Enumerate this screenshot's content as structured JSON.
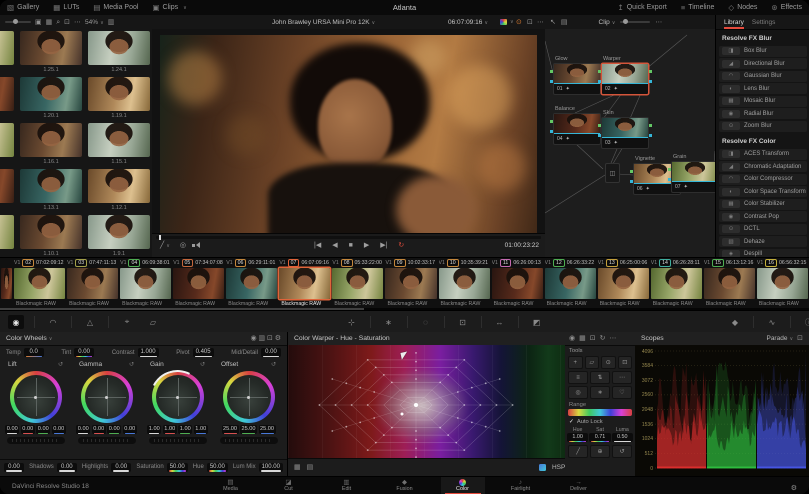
{
  "top_bar": {
    "gallery_label": "Gallery",
    "luts_label": "LUTs",
    "media_pool_label": "Media Pool",
    "clips_label": "Clips",
    "title": "Atlanta",
    "quick_export_label": "Quick Export",
    "timeline_label": "Timeline",
    "nodes_label": "Nodes",
    "effects_label": "Effects"
  },
  "gallery": {
    "zoom_level": "54%",
    "stills": [
      "1.25.1",
      "1.24.1",
      "1.20.1",
      "1.19.1",
      "1.16.1",
      "1.15.1",
      "1.13.1",
      "1.12.1",
      "1.10.1",
      "1.9.1"
    ]
  },
  "viewer": {
    "clip_name": "John Brawley URSA Mini Pro 12K",
    "timecode": "06:07:09:16",
    "duration": "01:00:23:22"
  },
  "node_graph": {
    "mode": "Clip",
    "nodes": [
      {
        "id": "01",
        "name": "Glow"
      },
      {
        "id": "02",
        "name": "Warper",
        "selected": true
      },
      {
        "id": "04",
        "name": "Balance"
      },
      {
        "id": "03",
        "name": "Skin"
      },
      {
        "id": "06",
        "name": "Vignette"
      },
      {
        "id": "07",
        "name": "Grain"
      }
    ]
  },
  "library": {
    "tabs": [
      "Library",
      "Settings"
    ],
    "active_tab": "Library",
    "sections": [
      {
        "title": "Resolve FX Blur",
        "items": [
          "Box Blur",
          "Directional Blur",
          "Gaussian Blur",
          "Lens Blur",
          "Mosaic Blur",
          "Radial Blur",
          "Zoom Blur"
        ]
      },
      {
        "title": "Resolve FX Color",
        "items": [
          "ACES Transform",
          "Chromatic Adaptation",
          "Color Compressor",
          "Color Space Transform",
          "Color Stabilizer",
          "Contrast Pop",
          "DCTL",
          "Dehaze",
          "Despill"
        ]
      }
    ]
  },
  "timeline": {
    "track": "V1",
    "format": "Blackmagic RAW",
    "clips": [
      {
        "num": "02",
        "tc": "07:02:09:12",
        "flag": "#c4873c"
      },
      {
        "num": "03",
        "tc": "07:47:11:13",
        "flag": "#a3a04a"
      },
      {
        "num": "04",
        "tc": "06:09:38:01",
        "flag": "#4fae52"
      },
      {
        "num": "05",
        "tc": "07:34:07:08",
        "flag": "#c4673c"
      },
      {
        "num": "06",
        "tc": "06:29:11:01",
        "flag": "#c4873c"
      },
      {
        "num": "07",
        "tc": "06:07:09:16",
        "flag": "#e0643a",
        "selected": true
      },
      {
        "num": "08",
        "tc": "05:33:22:00",
        "flag": "#c4873c"
      },
      {
        "num": "09",
        "tc": "10:02:33:17",
        "flag": "#c4873c"
      },
      {
        "num": "10",
        "tc": "10:35:39:21",
        "flag": "#c4873c"
      },
      {
        "num": "11",
        "tc": "06:26:00:13",
        "flag": "#c46ab0"
      },
      {
        "num": "12",
        "tc": "06:26:33:22",
        "flag": "#4fae52"
      },
      {
        "num": "13",
        "tc": "06:25:00:06",
        "flag": "#c4a03c"
      },
      {
        "num": "14",
        "tc": "06:26:28:11",
        "flag": "#3fae9e"
      },
      {
        "num": "15",
        "tc": "06:13:12:16",
        "flag": "#4fae52"
      },
      {
        "num": "16",
        "tc": "06:56:32:15",
        "flag": "#c4b03c"
      }
    ]
  },
  "wheels": {
    "header": "Color Wheels",
    "params": [
      {
        "label": "Temp",
        "value": "0.0"
      },
      {
        "label": "Tint",
        "value": "0.00"
      },
      {
        "label": "Contrast",
        "value": "1.000"
      },
      {
        "label": "Pivot",
        "value": "0.405"
      },
      {
        "label": "Mid/Detail",
        "value": "0.00"
      }
    ],
    "wheels": [
      {
        "name": "Lift",
        "values": [
          "0.00",
          "0.00",
          "0.00",
          "0.00"
        ]
      },
      {
        "name": "Gamma",
        "values": [
          "0.00",
          "0.00",
          "0.00",
          "0.00"
        ]
      },
      {
        "name": "Gain",
        "values": [
          "1.00",
          "1.00",
          "1.00",
          "1.00"
        ]
      },
      {
        "name": "Offset",
        "values": [
          "25.00",
          "25.00",
          "25.00"
        ]
      }
    ],
    "bottom_params": [
      {
        "label": "",
        "value": "0.00"
      },
      {
        "label": "Shadows",
        "value": "0.00"
      },
      {
        "label": "Highlights",
        "value": "0.00"
      },
      {
        "label": "Saturation",
        "value": "50.00"
      },
      {
        "label": "Hue",
        "value": "50.00"
      },
      {
        "label": "Lum Mix",
        "value": "100.00"
      }
    ]
  },
  "warper": {
    "header": "Color Warper - Hue - Saturation",
    "space": "HSP"
  },
  "tools": {
    "header": "Tools",
    "range_label": "Range",
    "auto_lock_label": "Auto Lock",
    "values": [
      {
        "label": "Hue",
        "value": "1.00"
      },
      {
        "label": "Sat",
        "value": "0.71"
      },
      {
        "label": "Luma",
        "value": "0.50"
      }
    ]
  },
  "scopes": {
    "header": "Scopes",
    "mode": "Parade",
    "ticks": [
      "4096",
      "3584",
      "3072",
      "2560",
      "2048",
      "1536",
      "1024",
      "512",
      "0"
    ]
  },
  "bottom_bar": {
    "app_name": "DaVinci Resolve Studio 18",
    "pages": [
      {
        "label": "Media"
      },
      {
        "label": "Cut"
      },
      {
        "label": "Edit"
      },
      {
        "label": "Fusion"
      },
      {
        "label": "Color",
        "active": true
      },
      {
        "label": "Fairlight"
      },
      {
        "label": "Deliver"
      }
    ]
  },
  "accent": {
    "selection": "#e0643a",
    "page_active": "#e64b3d"
  }
}
